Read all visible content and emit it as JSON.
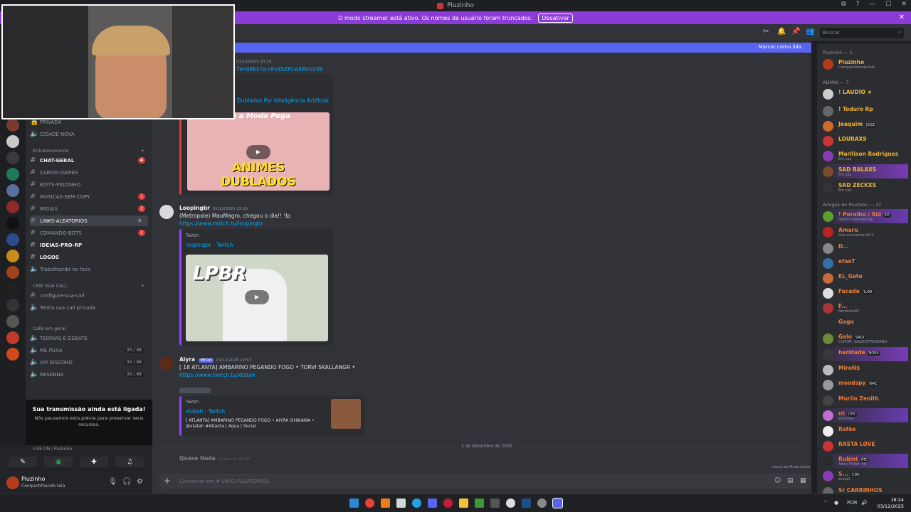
{
  "window": {
    "title": "Piuzinho",
    "controls": [
      "⧉",
      "?",
      "—",
      "☐",
      "✕"
    ]
  },
  "streamer_banner": {
    "text": "O modo streamer está ativo. Os nomes de usuário foram truncados.",
    "button": "Desativar"
  },
  "search": {
    "placeholder": "Buscar"
  },
  "new_messages": {
    "label": "Marcar como lida"
  },
  "channels": {
    "items": [
      {
        "name": "PRIVADA"
      },
      {
        "name": "CIDADE NOVA"
      },
      {
        "category": "Entretenimento"
      },
      {
        "name": "CHAT-GERAL",
        "badge": "4"
      },
      {
        "name": "CARGO-GAMES"
      },
      {
        "name": "EDITS-PIUZINHO"
      },
      {
        "name": "MUSICAS-SEM-COPY",
        "badge": "1"
      },
      {
        "name": "MIDIAS",
        "badge": "3"
      },
      {
        "name": "LINKS-ALEATORIOS"
      },
      {
        "name": "COMANDO-BOTS",
        "badge": "2"
      },
      {
        "name": "IDEIAS-PRO-RP"
      },
      {
        "name": "LOGOS"
      },
      {
        "name": "Trabalhando no foco"
      },
      {
        "category": "CRIE SUA CALL"
      },
      {
        "name": "configure-sua-call"
      },
      {
        "name": "Tenha sua call privada"
      },
      {
        "category": "Calls em geral"
      },
      {
        "name": "TEORIAS E DEBATE"
      },
      {
        "name": "ME PUXA",
        "count": "00 / 99"
      },
      {
        "name": "VIP DISCORD",
        "count": "00 / 99"
      },
      {
        "name": "RESENHA",
        "count": "00 / 99"
      }
    ]
  },
  "stream_popup": {
    "title": "Sua transmissão ainda está ligada!",
    "body": "Nós pausamos esta prévia para preservar seus recursos."
  },
  "voice": {
    "live": "LIVE ON / Piuzinho"
  },
  "user": {
    "name": "Piuzinho",
    "status": "Compartilhando tela"
  },
  "messages": {
    "m0": {
      "time": "01/12/2025 20:25",
      "link": "Tim08Kk?si=Px45ZPLwlI8VnV3B",
      "embed_title": "Dublados Por Inteligência Artificial",
      "thumb_text": "ANIMES DUBLADOS",
      "thumb_top": "Se a Moda Pega"
    },
    "m1": {
      "author": "Loopingbr",
      "time": "01/12/2025 22:26",
      "text": "(Metropole) MauMagro, chegou o dia!! !lp",
      "link": "https://www.twitch.tv/loopingbr",
      "embed_provider": "Twitch",
      "embed_title": "loopingbr - Twitch",
      "thumb_text": "LPBR"
    },
    "m2": {
      "author": "Aiyra",
      "tag": "MEOW",
      "time": "01/12/2025 22:57",
      "text": "[ 18 ATLANTA] AMBARINO PEGANDO FOGO • TORVI SKALLANGR •",
      "link": "https://www.twitch.tv/xtatah",
      "embed_provider": "Twitch",
      "embed_title": "xtatah - Twitch",
      "embed_desc": "[ ATLANTA] AMBARINO PEGANDO FOGO • AIYRA ISHIKAWA • @xtatah #Atlanta | Aqua | Social"
    },
    "m3": {
      "author": "Quase Nada",
      "time": "Ontem às 06:36"
    }
  },
  "date_divider": "2 de dezembro de 2025",
  "slow_mode": "Imune ao Modo Lento",
  "composer": {
    "placeholder": "Conversar em #  LINKS-ALEATORIOS"
  },
  "members": {
    "groups": [
      {
        "header": "Piuzinho — 1",
        "list": [
          {
            "name": "Piuzinho",
            "status": "Compartilhando tela",
            "color": "#f0b232"
          }
        ]
      },
      {
        "header": "ADMIN — 7",
        "list": [
          {
            "name": "! LAUDIO ★",
            "color": "#f0b232"
          },
          {
            "name": "! Toduro Rp",
            "color": "#f0b232"
          },
          {
            "name": "Joaquim",
            "tag": "JKGZ",
            "color": "#f0b232"
          },
          {
            "name": "LOURAX9",
            "color": "#f0b232"
          },
          {
            "name": "Marllison Rodrigues",
            "status": "Em voz",
            "color": "#f0b232"
          },
          {
            "name": "SAD BALAXS",
            "status": "Em voz",
            "color": "#f0b232"
          },
          {
            "name": "SAD ZECKXS",
            "status": "Em voz",
            "color": "#f0b232"
          }
        ]
      },
      {
        "header": "Amigos do Piuzinho — 21",
        "list": [
          {
            "name": "! Porolho / Sid",
            "tag": "EZ",
            "status": "twitch.tv/paralbaxp",
            "color": "#f37a34"
          },
          {
            "name": "Amaru",
            "status": "kick.com/amaru021",
            "color": "#f37a34"
          },
          {
            "name": "D...",
            "color": "#f37a34"
          },
          {
            "name": "efaeT",
            "color": "#f37a34"
          },
          {
            "name": "EL_Gato",
            "color": "#f37a34"
          },
          {
            "name": "Facada",
            "tag": "1v99",
            "color": "#f37a34"
          },
          {
            "name": "F...",
            "status": "NordesteRP",
            "color": "#f37a34"
          },
          {
            "name": "Gago",
            "color": "#f37a34"
          },
          {
            "name": "Galo",
            "tag": "SALV",
            "status": "CUPOM: SALVEOFWIDEANO",
            "color": "#f37a34"
          },
          {
            "name": "haridade",
            "tag": "NOR4",
            "color": "#f37a34"
          },
          {
            "name": "MiroN$",
            "color": "#f37a34"
          },
          {
            "name": "moodspy",
            "tag": "ᗰᗩᑕ",
            "color": "#f37a34"
          },
          {
            "name": "Murilo Zenith",
            "color": "#f37a34"
          },
          {
            "name": "nt",
            "tag": "CFX",
            "status": "entrinha",
            "color": "#f37a34"
          },
          {
            "name": "Rafão",
            "color": "#f37a34"
          },
          {
            "name": "RASTA LOVE",
            "color": "#f37a34"
          },
          {
            "name": "Rubini",
            "tag": "RTC",
            "status": "Alere Ticket: 40",
            "color": "#f37a34"
          },
          {
            "name": "S...",
            "tag": "CDA",
            "status": "scoopi",
            "color": "#f37a34"
          },
          {
            "name": "Sr CARRINHOS",
            "color": "#f37a34"
          }
        ]
      }
    ]
  },
  "taskbar": {
    "lang": "POR",
    "time": "18:24",
    "date": "03/12/2025"
  },
  "colors": {
    "accent": "#5865f2",
    "banner": "#8c3bd8",
    "link": "#00a8fc"
  }
}
